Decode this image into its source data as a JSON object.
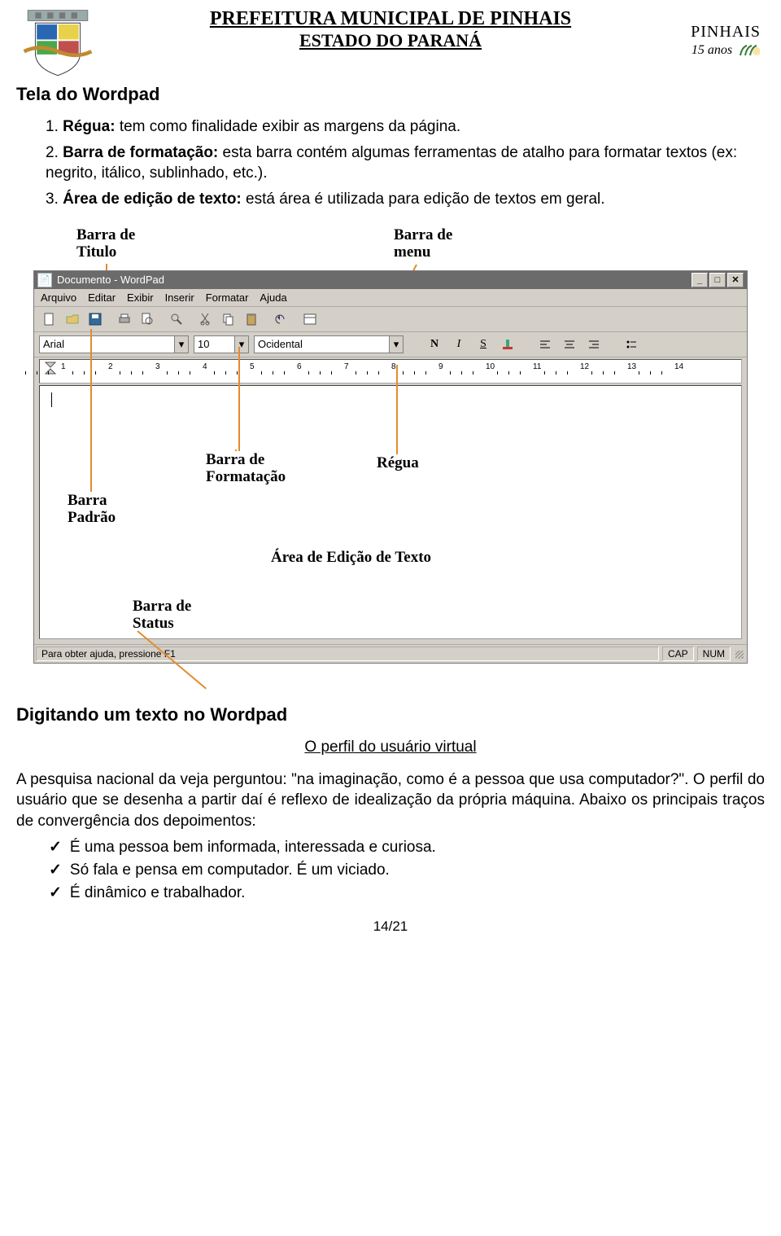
{
  "header": {
    "title1": "PREFEITURA MUNICIPAL DE PINHAIS",
    "title2": "ESTADO DO PARANÁ",
    "brand": "PINHAIS",
    "anos": "15 anos"
  },
  "section1_title": "Tela do Wordpad",
  "items": [
    {
      "n": "1.",
      "b": "Régua:",
      "t": " tem como finalidade exibir as margens da página."
    },
    {
      "n": "2.",
      "b": "Barra de formatação:",
      "t": " esta barra contém algumas ferramentas de atalho para formatar textos (ex: negrito, itálico, sublinhado, etc.)."
    },
    {
      "n": "3.",
      "b": "Área de edição de texto:",
      "t": " está área é utilizada para edição de textos em geral."
    }
  ],
  "callouts": {
    "titulo": "Barra de\nTitulo",
    "menu": "Barra de\nmenu",
    "padrao": "Barra\nPadrão",
    "formatacao": "Barra de\nFormatação",
    "regua": "Régua",
    "edicao": "Área de Edição de Texto",
    "status": "Barra de\nStatus"
  },
  "wordpad": {
    "title": "Documento - WordPad",
    "menu": [
      "Arquivo",
      "Editar",
      "Exibir",
      "Inserir",
      "Formatar",
      "Ajuda"
    ],
    "font": "Arial",
    "size": "10",
    "script": "Ocidental",
    "bold": "N",
    "italic": "I",
    "under": "S",
    "color_icon": "color-icon",
    "align_icons": [
      "align-left-icon",
      "align-center-icon",
      "align-right-icon",
      "bullets-icon"
    ],
    "ruler_ticks": [
      "1",
      "2",
      "3",
      "4",
      "5",
      "6",
      "7",
      "8",
      "9",
      "10",
      "11",
      "12",
      "13",
      "14"
    ],
    "status": "Para obter ajuda, pressione F1",
    "cap": "CAP",
    "num": "NUM"
  },
  "section2_title": "Digitando um texto no Wordpad",
  "subheading": "O perfil do usuário virtual",
  "para1": "A pesquisa nacional da veja perguntou: \"na imaginação, como é a pessoa que usa computador?\". O perfil do usuário que se desenha a partir daí é reflexo de idealização da própria máquina. Abaixo os principais traços de convergência dos depoimentos:",
  "checks": [
    "É uma pessoa bem informada, interessada e curiosa.",
    "Só fala e pensa em computador. É um viciado.",
    "É dinâmico e trabalhador."
  ],
  "page": "14/21"
}
